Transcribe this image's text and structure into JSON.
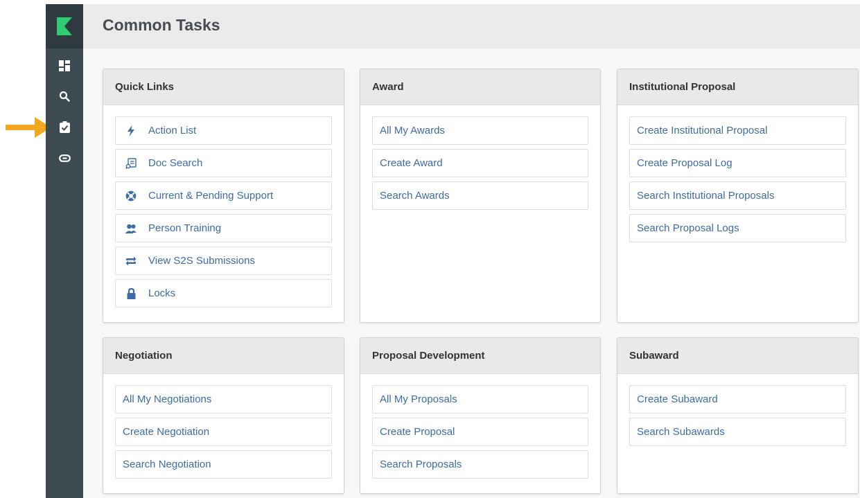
{
  "header": {
    "title": "Common Tasks"
  },
  "sidebar": {
    "items": [
      {
        "name": "dashboard",
        "icon": "dashboard-icon"
      },
      {
        "name": "search",
        "icon": "search-icon"
      },
      {
        "name": "common-tasks",
        "icon": "clipboard-check-icon"
      },
      {
        "name": "links",
        "icon": "link-icon"
      }
    ]
  },
  "panels": {
    "quick_links": {
      "title": "Quick Links",
      "items": [
        {
          "label": "Action List",
          "icon": "bolt-icon"
        },
        {
          "label": "Doc Search",
          "icon": "document-search-icon"
        },
        {
          "label": "Current & Pending Support",
          "icon": "life-ring-icon"
        },
        {
          "label": "Person Training",
          "icon": "users-icon"
        },
        {
          "label": "View S2S Submissions",
          "icon": "exchange-icon"
        },
        {
          "label": "Locks",
          "icon": "lock-icon"
        }
      ]
    },
    "award": {
      "title": "Award",
      "items": [
        "All My Awards",
        "Create Award",
        "Search Awards"
      ]
    },
    "institutional_proposal": {
      "title": "Institutional Proposal",
      "items": [
        "Create Institutional Proposal",
        "Create Proposal Log",
        "Search Institutional Proposals",
        "Search Proposal Logs"
      ]
    },
    "negotiation": {
      "title": "Negotiation",
      "items": [
        "All My Negotiations",
        "Create Negotiation",
        "Search Negotiation"
      ]
    },
    "proposal_development": {
      "title": "Proposal Development",
      "items": [
        "All My Proposals",
        "Create Proposal",
        "Search Proposals"
      ]
    },
    "subaward": {
      "title": "Subaward",
      "items": [
        "Create Subaward",
        "Search Subawards"
      ]
    }
  },
  "colors": {
    "sidebar": "#3d4a52",
    "logo_accent": "#2ecc71",
    "link": "#3f6ba4",
    "pointer": "#f0a81e"
  }
}
